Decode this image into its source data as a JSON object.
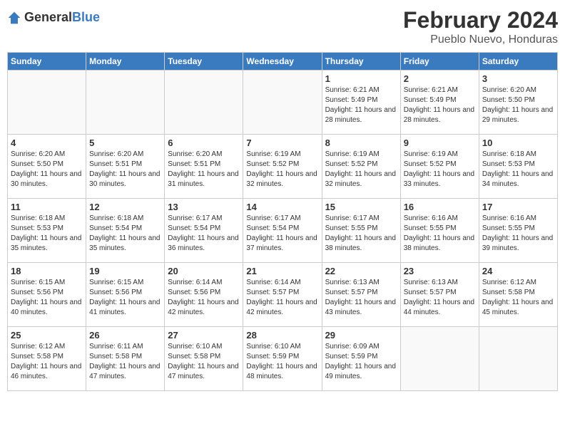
{
  "logo": {
    "general": "General",
    "blue": "Blue"
  },
  "title": {
    "month_year": "February 2024",
    "location": "Pueblo Nuevo, Honduras"
  },
  "weekdays": [
    "Sunday",
    "Monday",
    "Tuesday",
    "Wednesday",
    "Thursday",
    "Friday",
    "Saturday"
  ],
  "weeks": [
    [
      {
        "day": "",
        "info": ""
      },
      {
        "day": "",
        "info": ""
      },
      {
        "day": "",
        "info": ""
      },
      {
        "day": "",
        "info": ""
      },
      {
        "day": "1",
        "info": "Sunrise: 6:21 AM\nSunset: 5:49 PM\nDaylight: 11 hours\nand 28 minutes."
      },
      {
        "day": "2",
        "info": "Sunrise: 6:21 AM\nSunset: 5:49 PM\nDaylight: 11 hours\nand 28 minutes."
      },
      {
        "day": "3",
        "info": "Sunrise: 6:20 AM\nSunset: 5:50 PM\nDaylight: 11 hours\nand 29 minutes."
      }
    ],
    [
      {
        "day": "4",
        "info": "Sunrise: 6:20 AM\nSunset: 5:50 PM\nDaylight: 11 hours\nand 30 minutes."
      },
      {
        "day": "5",
        "info": "Sunrise: 6:20 AM\nSunset: 5:51 PM\nDaylight: 11 hours\nand 30 minutes."
      },
      {
        "day": "6",
        "info": "Sunrise: 6:20 AM\nSunset: 5:51 PM\nDaylight: 11 hours\nand 31 minutes."
      },
      {
        "day": "7",
        "info": "Sunrise: 6:19 AM\nSunset: 5:52 PM\nDaylight: 11 hours\nand 32 minutes."
      },
      {
        "day": "8",
        "info": "Sunrise: 6:19 AM\nSunset: 5:52 PM\nDaylight: 11 hours\nand 32 minutes."
      },
      {
        "day": "9",
        "info": "Sunrise: 6:19 AM\nSunset: 5:52 PM\nDaylight: 11 hours\nand 33 minutes."
      },
      {
        "day": "10",
        "info": "Sunrise: 6:18 AM\nSunset: 5:53 PM\nDaylight: 11 hours\nand 34 minutes."
      }
    ],
    [
      {
        "day": "11",
        "info": "Sunrise: 6:18 AM\nSunset: 5:53 PM\nDaylight: 11 hours\nand 35 minutes."
      },
      {
        "day": "12",
        "info": "Sunrise: 6:18 AM\nSunset: 5:54 PM\nDaylight: 11 hours\nand 35 minutes."
      },
      {
        "day": "13",
        "info": "Sunrise: 6:17 AM\nSunset: 5:54 PM\nDaylight: 11 hours\nand 36 minutes."
      },
      {
        "day": "14",
        "info": "Sunrise: 6:17 AM\nSunset: 5:54 PM\nDaylight: 11 hours\nand 37 minutes."
      },
      {
        "day": "15",
        "info": "Sunrise: 6:17 AM\nSunset: 5:55 PM\nDaylight: 11 hours\nand 38 minutes."
      },
      {
        "day": "16",
        "info": "Sunrise: 6:16 AM\nSunset: 5:55 PM\nDaylight: 11 hours\nand 38 minutes."
      },
      {
        "day": "17",
        "info": "Sunrise: 6:16 AM\nSunset: 5:55 PM\nDaylight: 11 hours\nand 39 minutes."
      }
    ],
    [
      {
        "day": "18",
        "info": "Sunrise: 6:15 AM\nSunset: 5:56 PM\nDaylight: 11 hours\nand 40 minutes."
      },
      {
        "day": "19",
        "info": "Sunrise: 6:15 AM\nSunset: 5:56 PM\nDaylight: 11 hours\nand 41 minutes."
      },
      {
        "day": "20",
        "info": "Sunrise: 6:14 AM\nSunset: 5:56 PM\nDaylight: 11 hours\nand 42 minutes."
      },
      {
        "day": "21",
        "info": "Sunrise: 6:14 AM\nSunset: 5:57 PM\nDaylight: 11 hours\nand 42 minutes."
      },
      {
        "day": "22",
        "info": "Sunrise: 6:13 AM\nSunset: 5:57 PM\nDaylight: 11 hours\nand 43 minutes."
      },
      {
        "day": "23",
        "info": "Sunrise: 6:13 AM\nSunset: 5:57 PM\nDaylight: 11 hours\nand 44 minutes."
      },
      {
        "day": "24",
        "info": "Sunrise: 6:12 AM\nSunset: 5:58 PM\nDaylight: 11 hours\nand 45 minutes."
      }
    ],
    [
      {
        "day": "25",
        "info": "Sunrise: 6:12 AM\nSunset: 5:58 PM\nDaylight: 11 hours\nand 46 minutes."
      },
      {
        "day": "26",
        "info": "Sunrise: 6:11 AM\nSunset: 5:58 PM\nDaylight: 11 hours\nand 47 minutes."
      },
      {
        "day": "27",
        "info": "Sunrise: 6:10 AM\nSunset: 5:58 PM\nDaylight: 11 hours\nand 47 minutes."
      },
      {
        "day": "28",
        "info": "Sunrise: 6:10 AM\nSunset: 5:59 PM\nDaylight: 11 hours\nand 48 minutes."
      },
      {
        "day": "29",
        "info": "Sunrise: 6:09 AM\nSunset: 5:59 PM\nDaylight: 11 hours\nand 49 minutes."
      },
      {
        "day": "",
        "info": ""
      },
      {
        "day": "",
        "info": ""
      }
    ]
  ]
}
